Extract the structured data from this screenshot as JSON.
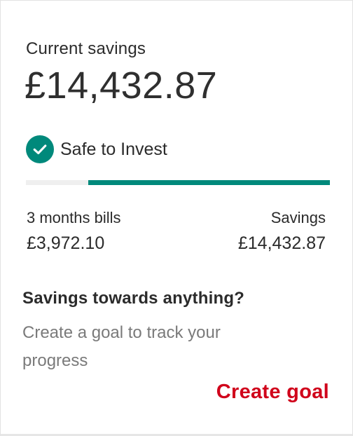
{
  "savings": {
    "label": "Current savings",
    "balance": "£14,432.87"
  },
  "status": {
    "icon": "check-circle-icon",
    "text": "Safe to Invest"
  },
  "progress": {
    "bills_fraction": 0.206
  },
  "stats": {
    "bills_label": "3 months bills",
    "bills_value": "£3,972.10",
    "savings_label": "Savings",
    "savings_value": "£14,432.87"
  },
  "goal_prompt": {
    "heading": "Savings towards anything?",
    "text": "Create a goal to track your progress",
    "action_label": "Create goal"
  },
  "colors": {
    "accent": "#00897b",
    "action": "#d0021b",
    "track": "#efefef"
  }
}
